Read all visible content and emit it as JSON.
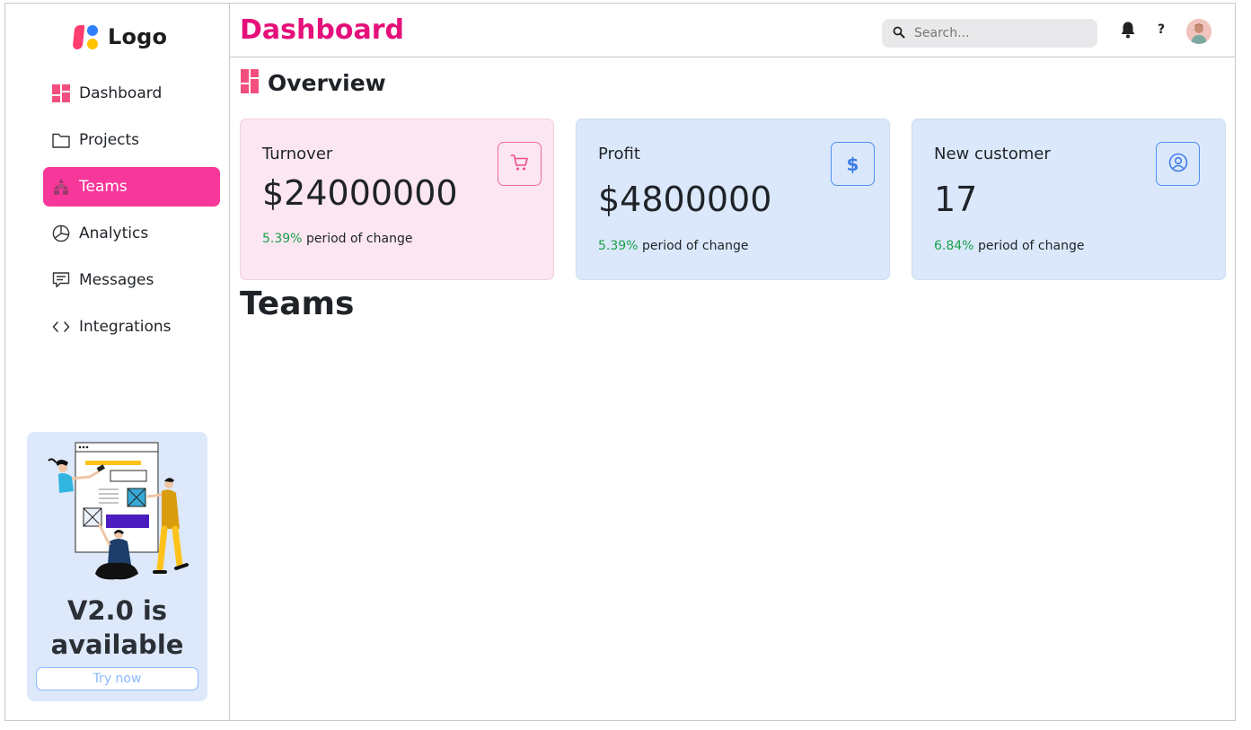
{
  "logo": {
    "text": "Logo"
  },
  "sidebar": {
    "items": [
      {
        "label": "Dashboard",
        "icon": "dashboard-icon",
        "active": false
      },
      {
        "label": "Projects",
        "icon": "folder-icon",
        "active": false
      },
      {
        "label": "Teams",
        "icon": "team-icon",
        "active": true
      },
      {
        "label": "Analytics",
        "icon": "pie-chart-icon",
        "active": false
      },
      {
        "label": "Messages",
        "icon": "message-icon",
        "active": false
      },
      {
        "label": "Integrations",
        "icon": "code-icon",
        "active": false
      }
    ],
    "promo": {
      "title": "V2.0 is available",
      "button_label": "Try now"
    }
  },
  "header": {
    "title": "Dashboard",
    "search_placeholder": "Search...",
    "help_label": "?"
  },
  "overview": {
    "title": "Overview",
    "cards": [
      {
        "label": "Turnover",
        "value": "$24000000",
        "change_pct": "5.39%",
        "change_text": "period of change",
        "icon": "cart-icon"
      },
      {
        "label": "Profit",
        "value": "$4800000",
        "change_pct": "5.39%",
        "change_text": "period of change",
        "icon": "dollar-icon"
      },
      {
        "label": "New customer",
        "value": "17",
        "change_pct": "6.84%",
        "change_text": "period of change",
        "icon": "user-circle-icon"
      }
    ]
  },
  "teams": {
    "title": "Teams"
  },
  "colors": {
    "accent": "#e5107a",
    "active_nav": "#f8379b",
    "positive": "#1aa04a",
    "card_pink": "#fce6f1",
    "card_blue": "#dbe8fb"
  }
}
